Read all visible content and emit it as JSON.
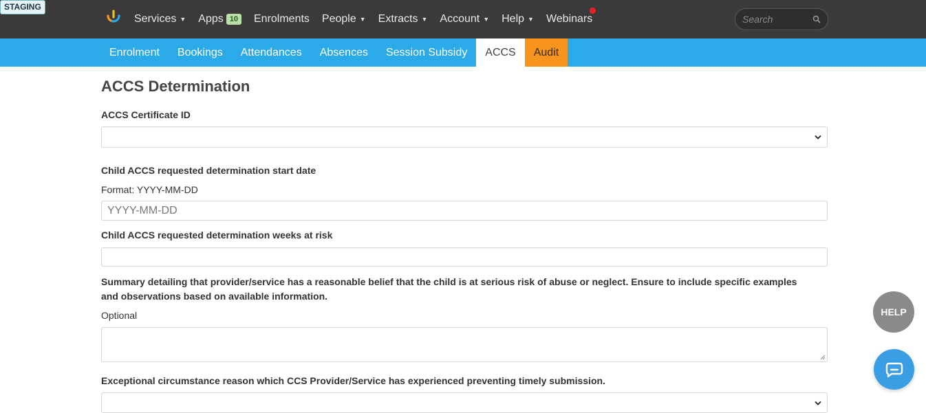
{
  "badge": {
    "environment": "STAGING"
  },
  "topnav": {
    "items": [
      {
        "label": "Services",
        "caret": true
      },
      {
        "label": "Apps",
        "badge": "10",
        "caret": false
      },
      {
        "label": "Enrolments",
        "caret": false
      },
      {
        "label": "People",
        "caret": true
      },
      {
        "label": "Extracts",
        "caret": true
      },
      {
        "label": "Account",
        "caret": true
      },
      {
        "label": "Help",
        "caret": true
      },
      {
        "label": "Webinars",
        "caret": false
      }
    ],
    "search_placeholder": "Search"
  },
  "subnav": {
    "tabs": [
      {
        "label": "Enrolment"
      },
      {
        "label": "Bookings"
      },
      {
        "label": "Attendances"
      },
      {
        "label": "Absences"
      },
      {
        "label": "Session Subsidy"
      },
      {
        "label": "ACCS"
      },
      {
        "label": "Audit"
      }
    ],
    "active": "ACCS"
  },
  "form": {
    "title": "ACCS Determination",
    "certificate_label": "ACCS Certificate ID",
    "start_date_label": "Child ACCS requested determination start date",
    "start_date_format": "Format: YYYY-MM-DD",
    "start_date_placeholder": "YYYY-MM-DD",
    "weeks_label": "Child ACCS requested determination weeks at risk",
    "summary_label": "Summary detailing that provider/service has a reasonable belief that the child is at serious risk of abuse or neglect. Ensure to include specific examples and observations based on available information.",
    "summary_hint": "Optional",
    "exceptional_label": "Exceptional circumstance reason which CCS Provider/Service has experienced preventing timely submission."
  },
  "widgets": {
    "help_label": "HELP"
  },
  "colors": {
    "topbar": "#3a3a3a",
    "subbar": "#2aaae9",
    "audit_tab": "#f7941d",
    "apps_badge": "#b8e0a8",
    "notify_dot": "#ee1c25",
    "help_button": "#8a8a8a",
    "chat_button": "#3a9ee4"
  }
}
